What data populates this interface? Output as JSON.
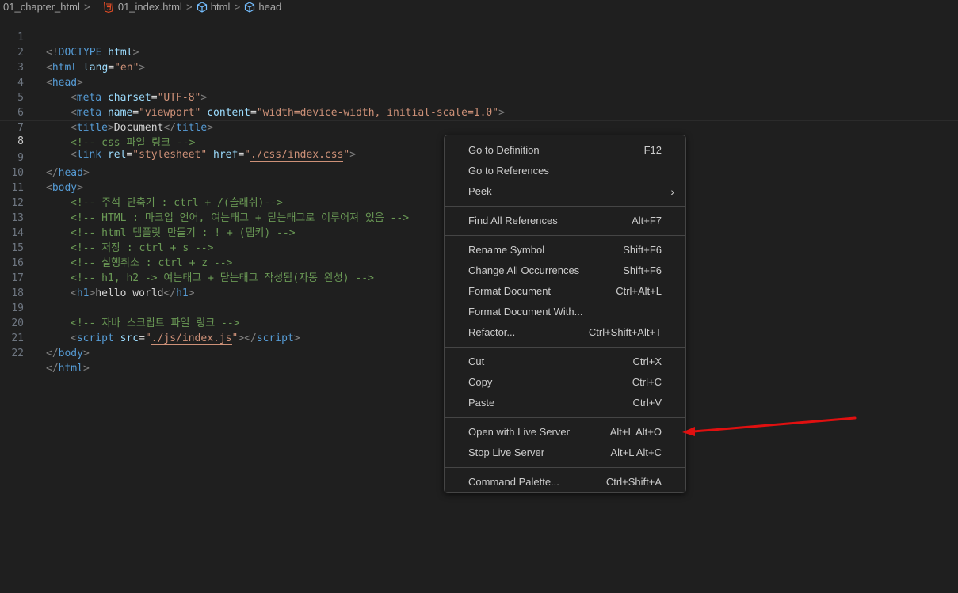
{
  "breadcrumb": {
    "folder": "01_chapter_html",
    "file": "01_index.html",
    "element1": "html",
    "element2": "head",
    "separator": ">"
  },
  "editor": {
    "lines": [
      {
        "n": "1"
      },
      {
        "n": "2"
      },
      {
        "n": "3"
      },
      {
        "n": "4"
      },
      {
        "n": "5"
      },
      {
        "n": "6"
      },
      {
        "n": "7"
      },
      {
        "n": "8"
      },
      {
        "n": "9"
      },
      {
        "n": "10"
      },
      {
        "n": "11"
      },
      {
        "n": "12"
      },
      {
        "n": "13"
      },
      {
        "n": "14"
      },
      {
        "n": "15"
      },
      {
        "n": "16"
      },
      {
        "n": "17"
      },
      {
        "n": "18"
      },
      {
        "n": "19"
      },
      {
        "n": "20"
      },
      {
        "n": "21"
      },
      {
        "n": "22"
      }
    ],
    "code": {
      "l1": [
        "<!",
        "DOCTYPE",
        " html",
        ">"
      ],
      "l2": [
        "<",
        "html",
        " lang",
        "=",
        "\"en\"",
        ">"
      ],
      "l3": [
        "<",
        "head",
        ">"
      ],
      "l4": [
        "<",
        "meta",
        " charset",
        "=",
        "\"UTF-8\"",
        ">"
      ],
      "l5": [
        "<",
        "meta",
        " name",
        "=",
        "\"viewport\"",
        " content",
        "=",
        "\"width=device-width, initial-scale=1.0\"",
        ">"
      ],
      "l6": [
        "<",
        "title",
        ">",
        "Document",
        "</",
        "title",
        ">"
      ],
      "l7": "<!-- css 파일 링크 -->",
      "l8": [
        "<",
        "link",
        " rel",
        "=",
        "\"stylesheet\"",
        " href",
        "=",
        "\"",
        "./css/index.css",
        "\"",
        ">"
      ],
      "l9": [
        "</",
        "head",
        ">"
      ],
      "l10": [
        "<",
        "body",
        ">"
      ],
      "l11": "<!-- 주석 단축기 : ctrl + /(슬래쉬)-->",
      "l12": "<!-- HTML : 마크업 언어, 여는태그 + 닫는태그로 이루어져 있음 -->",
      "l13": "<!-- html 템플릿 만들기 : ! + (탭키) -->",
      "l14": "<!-- 저장 : ctrl + s -->",
      "l15": "<!-- 실행취소 : ctrl + z -->",
      "l16": "<!-- h1, h2 -> 여는태그 + 닫는태그 작성됨(자동 완성) -->",
      "l17": [
        "<",
        "h1",
        ">",
        "hello world",
        "</",
        "h1",
        ">"
      ],
      "l18": "",
      "l19": "<!-- 자바 스크립트 파일 링크 -->",
      "l20": [
        "<",
        "script",
        " src",
        "=",
        "\"",
        "./js/index.js",
        "\"",
        "></",
        "script",
        ">"
      ],
      "l21": [
        "</",
        "body",
        ">"
      ],
      "l22": [
        "</",
        "html",
        ">"
      ]
    }
  },
  "menu": {
    "items": [
      {
        "label": "Go to Definition",
        "kb": "F12"
      },
      {
        "label": "Go to References",
        "kb": ""
      },
      {
        "label": "Peek",
        "kb": ""
      },
      {
        "label": "Find All References",
        "kb": "Alt+F7"
      },
      {
        "label": "Rename Symbol",
        "kb": "Shift+F6"
      },
      {
        "label": "Change All Occurrences",
        "kb": "Shift+F6"
      },
      {
        "label": "Format Document",
        "kb": "Ctrl+Alt+L"
      },
      {
        "label": "Format Document With...",
        "kb": ""
      },
      {
        "label": "Refactor...",
        "kb": "Ctrl+Shift+Alt+T"
      },
      {
        "label": "Cut",
        "kb": "Ctrl+X"
      },
      {
        "label": "Copy",
        "kb": "Ctrl+C"
      },
      {
        "label": "Paste",
        "kb": "Ctrl+V"
      },
      {
        "label": "Open with Live Server",
        "kb": "Alt+L Alt+O"
      },
      {
        "label": "Stop Live Server",
        "kb": "Alt+L Alt+C"
      },
      {
        "label": "Command Palette...",
        "kb": "Ctrl+Shift+A"
      }
    ],
    "peek_chevron": "›"
  },
  "colors": {
    "background": "#1f1f1f",
    "tag": "#569cd6",
    "attribute": "#9cdcfe",
    "string": "#ce9178",
    "comment": "#6a9955",
    "annotation_arrow": "#e01010"
  },
  "icons": {
    "file": "html5-icon",
    "element": "cube-icon",
    "annotation": "red-arrow"
  }
}
